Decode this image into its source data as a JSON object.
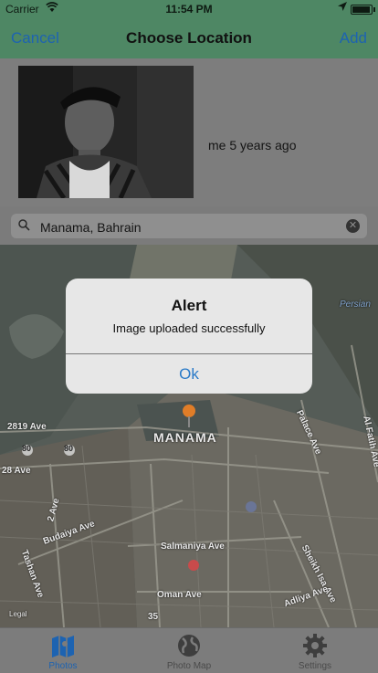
{
  "status_bar": {
    "carrier": "Carrier",
    "time": "11:54 PM"
  },
  "nav": {
    "cancel_label": "Cancel",
    "title": "Choose Location",
    "add_label": "Add"
  },
  "post": {
    "caption": "me 5 years ago"
  },
  "search": {
    "value": "Manama, Bahrain",
    "clear_icon": "clear-icon"
  },
  "map": {
    "city_label": "MANAMA",
    "street_labels": [
      "2819 Ave",
      "28 Ave",
      "2 Ave",
      "Budaiya Ave",
      "Salmaniya Ave",
      "Oman Ave",
      "Tashan Ave",
      "Palace Ave",
      "Al Fatih Ave",
      "Sheikh Isa Ave",
      "Adliya Ave",
      "35",
      "Persian"
    ],
    "highway_shields": [
      "80",
      "80"
    ],
    "legal_label": "Legal",
    "pin_color": "#e07d28"
  },
  "alert": {
    "title": "Alert",
    "message": "Image uploaded successfully",
    "ok_label": "Ok"
  },
  "tabs": [
    {
      "label": "Photos",
      "icon": "map-book-icon",
      "active": true
    },
    {
      "label": "Photo Map",
      "icon": "globe-icon",
      "active": false
    },
    {
      "label": "Settings",
      "icon": "gear-icon",
      "active": false
    }
  ],
  "colors": {
    "accent": "#1d63b1",
    "navbar": "#4e8764",
    "alert_button": "#2a7ac8"
  }
}
